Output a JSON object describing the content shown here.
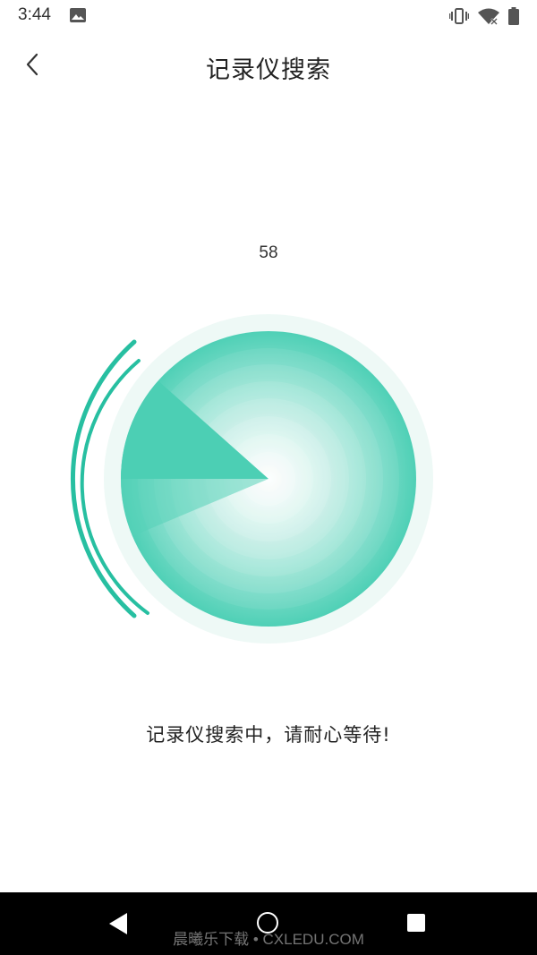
{
  "status_bar": {
    "time": "3:44",
    "icons": [
      "image-icon",
      "vibrate-icon",
      "wifi-icon",
      "battery-icon"
    ]
  },
  "header": {
    "title": "记录仪搜索",
    "back_icon": "chevron-left-icon"
  },
  "countdown": {
    "value": "58"
  },
  "radar": {
    "accent_color": "#3ccbb0",
    "light_color": "#e8f8f4"
  },
  "message": {
    "text": "记录仪搜索中，请耐心等待!"
  },
  "nav_bar": {
    "icons": [
      "nav-back-icon",
      "nav-home-icon",
      "nav-recent-icon"
    ],
    "watermark": "晨曦乐下载 • CXLEDU.COM"
  }
}
